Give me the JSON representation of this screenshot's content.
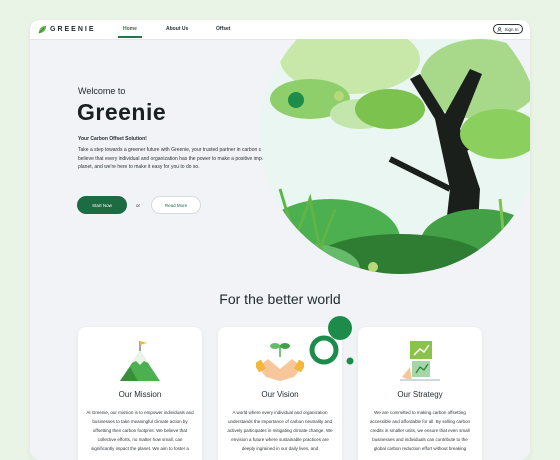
{
  "nav": {
    "logo": "GREENIE",
    "links": [
      {
        "label": "Home"
      },
      {
        "label": "About Us"
      },
      {
        "label": "Offset"
      }
    ],
    "signin": "Sign In"
  },
  "hero": {
    "welcome": "Welcome to",
    "title": "Greenie",
    "subtitle": "Your Carbon Offset Solution!",
    "description": "Take a step towards a greener future with Greenie, your trusted partner in carbon offsetting. We believe that every individual and organization has the power to make a positive impact on the planet, and we're here to make it easy for you to do so.",
    "primary_button": "Start Now",
    "or": "or",
    "secondary_button": "Read More"
  },
  "section": {
    "title": "For the better world"
  },
  "cards": [
    {
      "title": "Our Mission",
      "icon": "mountain-flag-icon",
      "text": "At Greenie, our mission is to empower individuals and businesses to take meaningful climate action by offsetting their carbon footprint. We believe that collective efforts, no matter how small, can significantly impact the planet. We aim to foster a"
    },
    {
      "title": "Our Vision",
      "icon": "handshake-sprout-icon",
      "text": "A world where every individual and organization understands the importance of carbon neutrality and actively participates in mitigating climate change. We envision a future where sustainable practices are deeply ingrained in our daily lives, and"
    },
    {
      "title": "Our Strategy",
      "icon": "strategy-chart-icon",
      "text": "We are committed to making carbon offsetting accessible and affordable for all. By selling carbon credits in smaller units, we ensure that even small businesses and individuals can contribute to the global carbon reduction effort without breaking"
    }
  ],
  "colors": {
    "brand": "#1d6b42",
    "accent": "#8bc34a",
    "background": "#f1f3f6"
  }
}
